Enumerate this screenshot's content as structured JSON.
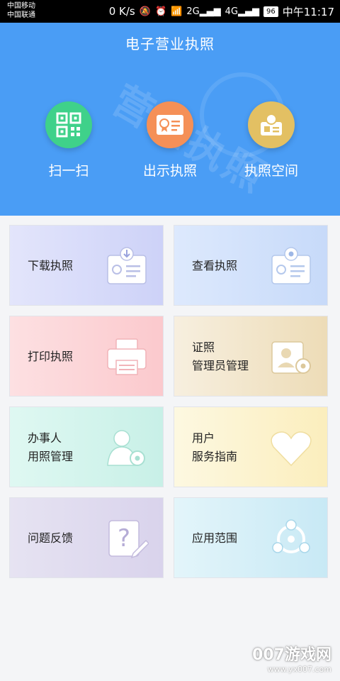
{
  "status_bar": {
    "carrier1": "中国移动",
    "carrier2": "中国联通",
    "speed": "0 K/s",
    "signal1": "2G",
    "signal2": "4G",
    "battery": "96",
    "time": "中午11:17"
  },
  "header": {
    "title": "电子营业执照",
    "watermark": "营业执照",
    "actions": [
      {
        "label": "扫一扫",
        "icon": "qr-code-icon",
        "color": "#3fd18a"
      },
      {
        "label": "出示执照",
        "icon": "license-card-icon",
        "color": "#f59057"
      },
      {
        "label": "执照空间",
        "icon": "license-space-icon",
        "color": "#e3c063"
      }
    ]
  },
  "grid": [
    {
      "line1": "下载执照",
      "line2": "",
      "icon": "download-license-icon",
      "colors": [
        "#e3e5fb",
        "#cdd2f8"
      ]
    },
    {
      "line1": "查看执照",
      "line2": "",
      "icon": "view-license-icon",
      "colors": [
        "#dde9fd",
        "#c7daf9"
      ]
    },
    {
      "line1": "打印执照",
      "line2": "",
      "icon": "printer-icon",
      "colors": [
        "#fde0e2",
        "#fbc9cd"
      ]
    },
    {
      "line1": "证照",
      "line2": "管理员管理",
      "icon": "admin-manage-icon",
      "colors": [
        "#f7efdf",
        "#eddcb7"
      ]
    },
    {
      "line1": "办事人",
      "line2": "用照管理",
      "icon": "user-manage-icon",
      "colors": [
        "#dff8f2",
        "#c8f0e7"
      ]
    },
    {
      "line1": "用户",
      "line2": "服务指南",
      "icon": "heart-icon",
      "colors": [
        "#fdf8e1",
        "#fbeebd"
      ]
    },
    {
      "line1": "问题反馈",
      "line2": "",
      "icon": "feedback-icon",
      "colors": [
        "#e6e3f2",
        "#d9d3ec"
      ]
    },
    {
      "line1": "应用范围",
      "line2": "",
      "icon": "scope-icon",
      "colors": [
        "#e3f5fa",
        "#c8e9f5"
      ]
    }
  ],
  "watermark_site": {
    "name": "007游戏网",
    "url": "www.yx007.com"
  }
}
